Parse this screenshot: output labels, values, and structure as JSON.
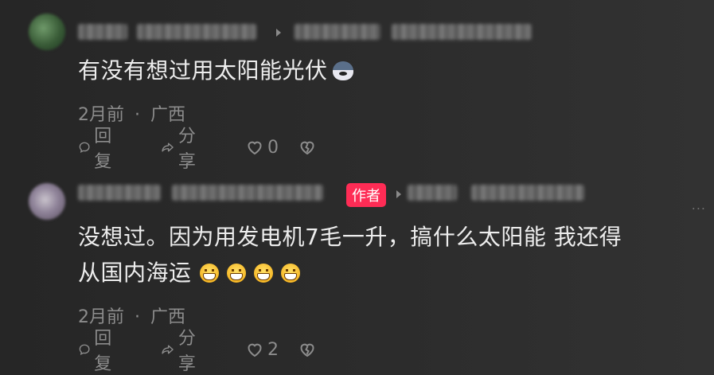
{
  "comments": [
    {
      "text": "有没有想过用太阳能光伏",
      "emoji": "dog-face-emoji",
      "time": "2月前",
      "location": "广西",
      "reply_label": "回复",
      "share_label": "分享",
      "like_count": "0"
    },
    {
      "author_badge": "作者",
      "text_line1": "没想过。因为用发电机7毛一升，搞什么太阳能 我还得",
      "text_line2": "从国内海运",
      "time": "2月前",
      "location": "广西",
      "reply_label": "回复",
      "share_label": "分享",
      "like_count": "2",
      "more_label": "..."
    }
  ],
  "separator": "·",
  "colors": {
    "badge": "#fe2c55",
    "text": "#ededed",
    "muted": "#8c8c8c"
  }
}
